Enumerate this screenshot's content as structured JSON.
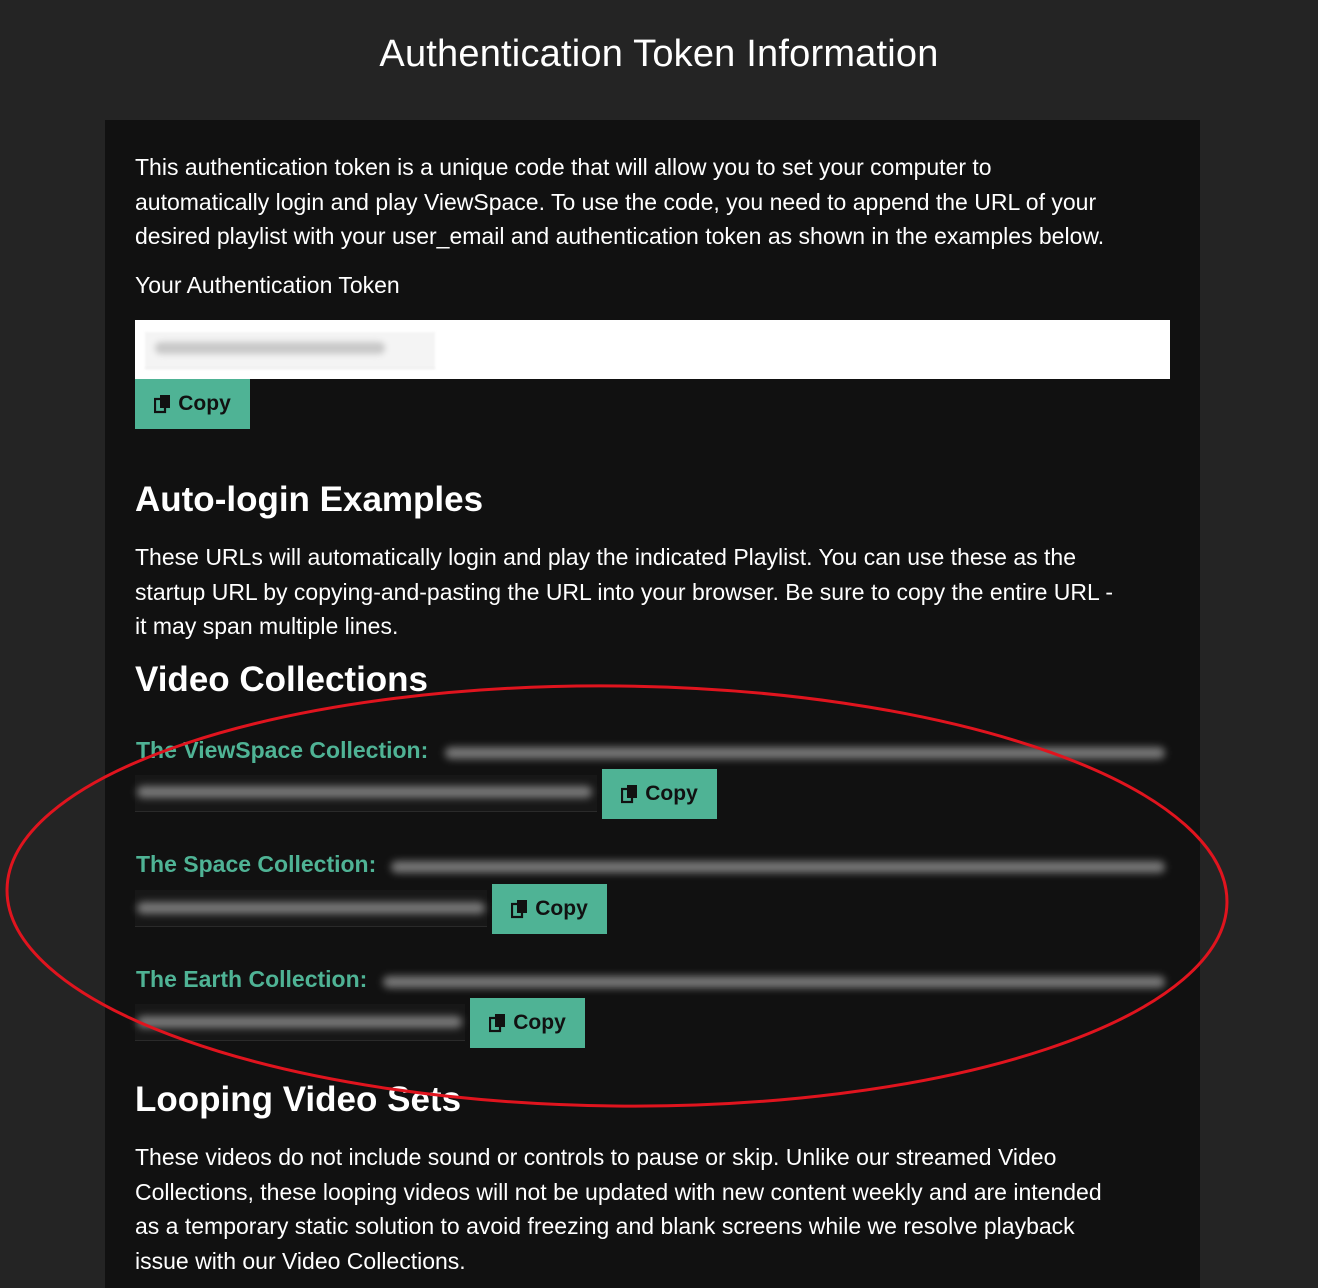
{
  "page": {
    "title": "Authentication Token Information"
  },
  "intro": {
    "line1": "This authentication token is a unique code that will allow you to set your computer to",
    "line2": "automatically login and play ViewSpace. To use the code, you need to append the URL of your",
    "line3": "desired playlist with your user_email and authentication token as shown in the examples below."
  },
  "token": {
    "label": "Your Authentication Token",
    "copy_label": "Copy"
  },
  "autologin": {
    "heading": "Auto-login Examples",
    "line1": "These URLs will automatically login and play the indicated Playlist. You can use these as the",
    "line2": "startup URL by copying-and-pasting the URL into your browser. Be sure to copy the entire URL -",
    "line3": "it may span multiple lines."
  },
  "video_collections": {
    "heading": "Video Collections",
    "items": [
      {
        "label": "The ViewSpace Collection:",
        "copy_label": "Copy"
      },
      {
        "label": "The Space Collection:",
        "copy_label": "Copy"
      },
      {
        "label": "The Earth Collection:",
        "copy_label": "Copy"
      }
    ]
  },
  "looping": {
    "heading": "Looping Video Sets",
    "line1": "These videos do not include sound or controls to pause or skip. Unlike our streamed Video",
    "line2": "Collections, these looping videos will not be updated with new content weekly and are intended",
    "line3": "as a temporary static solution to avoid freezing and blank screens while we resolve playback",
    "line4": "issue with our Video Collections."
  },
  "colors": {
    "background": "#242424",
    "panel": "#111111",
    "accent": "#4fb395",
    "annotation_ellipse": "#e0141e"
  },
  "icons": {
    "copy": "copy-icon"
  }
}
